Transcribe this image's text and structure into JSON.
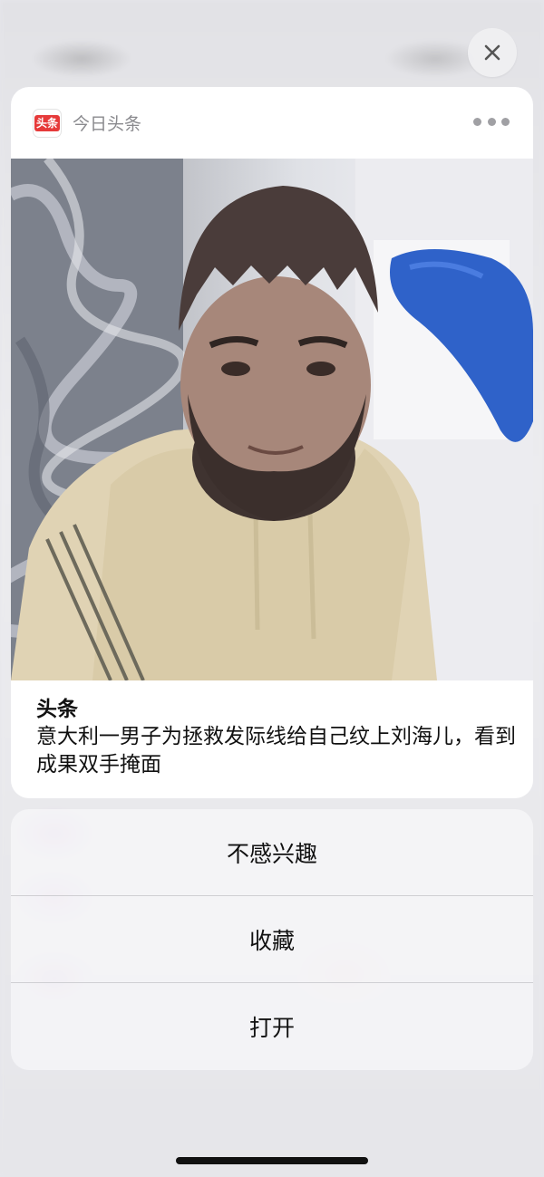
{
  "notification": {
    "app_name": "今日头条",
    "app_icon_text": "头条",
    "title": "头条",
    "body": "意大利一男子为拯救发际线给自己纹上刘海儿，看到成果双手掩面"
  },
  "menu": {
    "items": [
      {
        "label": "不感兴趣"
      },
      {
        "label": "收藏"
      },
      {
        "label": "打开"
      }
    ]
  },
  "icons": {
    "close": "close-icon",
    "more": "more-dots-icon"
  }
}
